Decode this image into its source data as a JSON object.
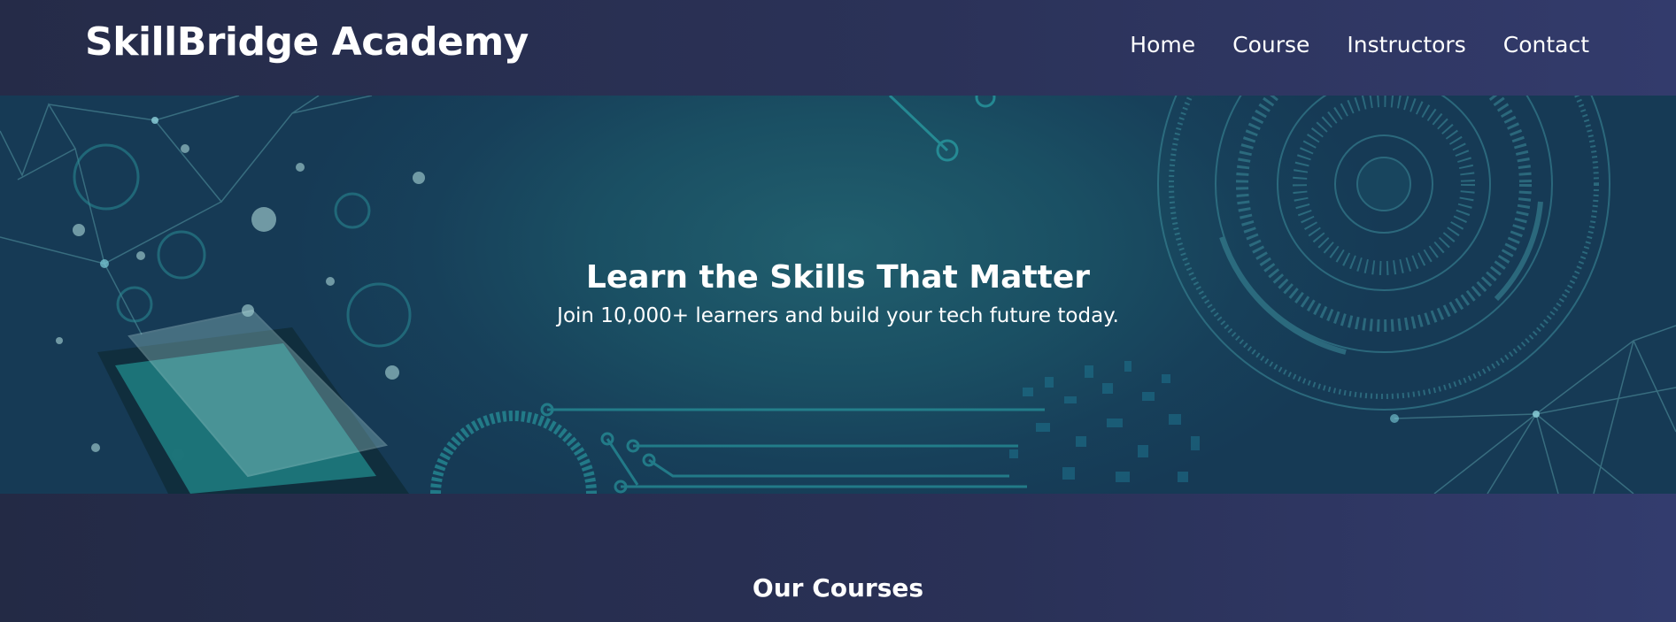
{
  "header": {
    "brand": "SkillBridge Academy",
    "nav": [
      {
        "label": "Home"
      },
      {
        "label": "Course"
      },
      {
        "label": "Instructors"
      },
      {
        "label": "Contact"
      }
    ]
  },
  "hero": {
    "title": "Learn the Skills That Matter",
    "subtitle": "Join 10,000+ learners and build your tech future today."
  },
  "courses": {
    "title": "Our Courses"
  },
  "colors": {
    "navbar": "#2b3258",
    "hero": "#1a4f63",
    "accent": "#2aa3a8"
  }
}
